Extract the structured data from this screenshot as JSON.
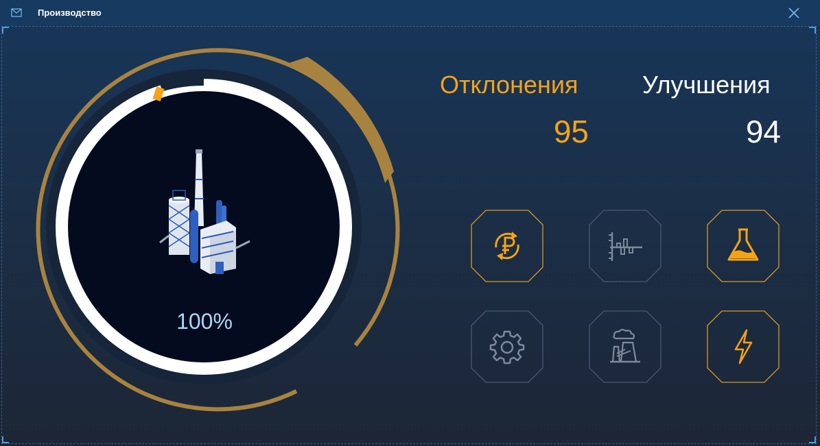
{
  "window": {
    "title": "Производство",
    "title_icon": "mail-icon",
    "close_icon": "close-icon"
  },
  "dial": {
    "percent_label": "100%",
    "progress_fraction": 1.0,
    "image": "refinery-plant-illustration"
  },
  "stats": {
    "deviations_label": "Отклонения",
    "deviations_value": "95",
    "improvements_label": "Улучшения",
    "improvements_value": "94"
  },
  "tiles": [
    {
      "icon": "ruble-exchange-icon",
      "active": true
    },
    {
      "icon": "chart-icon",
      "active": false
    },
    {
      "icon": "flask-icon",
      "active": true
    },
    {
      "icon": "gear-icon",
      "active": false
    },
    {
      "icon": "factory-icon",
      "active": false
    },
    {
      "icon": "lightning-icon",
      "active": true
    }
  ],
  "colors": {
    "accent_orange": "#f5a316",
    "gold_ring": "#a8833f",
    "inactive_icon": "#7d8a9c",
    "dial_center": "#040b1e",
    "title_bar": "#173a60"
  }
}
